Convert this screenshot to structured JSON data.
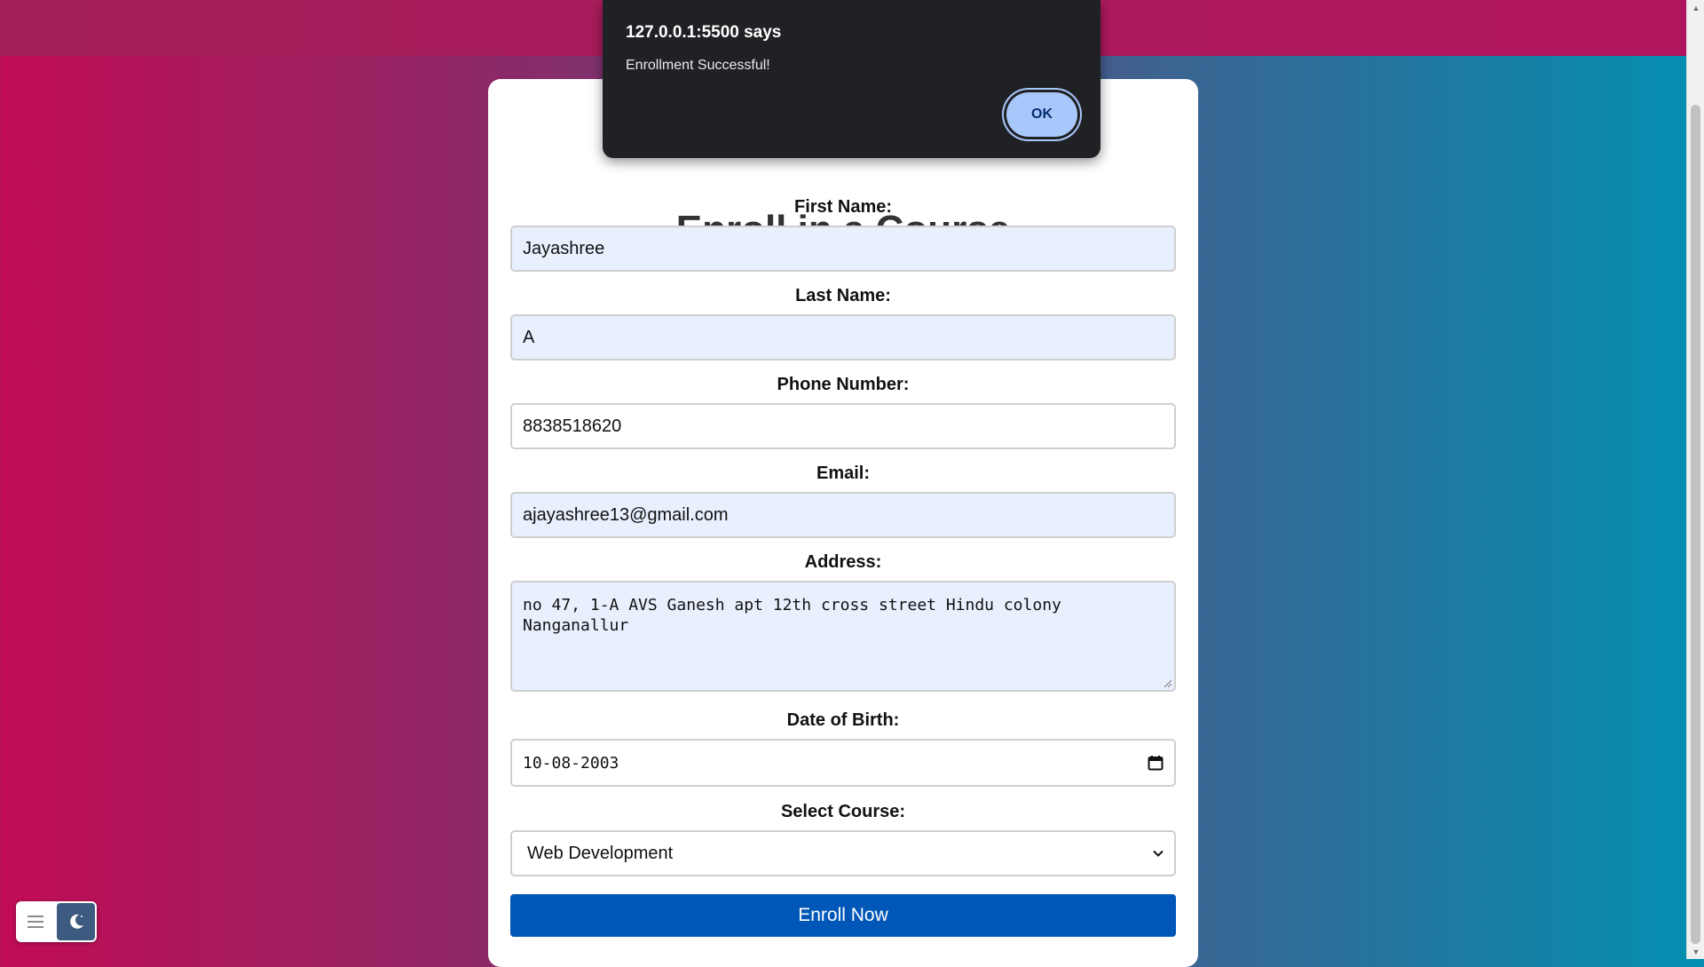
{
  "dialog": {
    "origin": "127.0.0.1:5500 says",
    "message": "Enrollment Successful!",
    "ok_label": "OK"
  },
  "form": {
    "title": "Enroll in a Course",
    "first_name": {
      "label": "First Name:",
      "value": "Jayashree"
    },
    "last_name": {
      "label": "Last Name:",
      "value": "A"
    },
    "phone": {
      "label": "Phone Number:",
      "value": "8838518620"
    },
    "email": {
      "label": "Email:",
      "value": "ajayashree13@gmail.com"
    },
    "address": {
      "label": "Address:",
      "value": "no 47, 1-A AVS Ganesh apt 12th cross street Hindu colony\nNanganallur"
    },
    "dob": {
      "label": "Date of Birth:",
      "value": "10-08-2003"
    },
    "course": {
      "label": "Select Course:",
      "selected": "Web Development"
    },
    "submit_label": "Enroll Now"
  },
  "colors": {
    "submit": "#0057b8",
    "dialog_bg": "#202124",
    "ok_button": "#a8c7fa",
    "autofill": "#e8f0fe"
  },
  "icons": {
    "calendar": "calendar-icon",
    "select_arrow": "chevron-down-icon",
    "menu": "hamburger-menu-icon",
    "theme": "moon-icon"
  }
}
